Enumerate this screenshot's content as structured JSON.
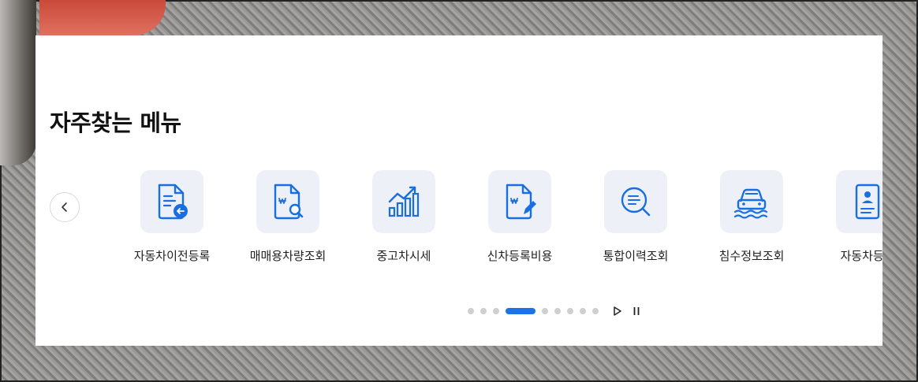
{
  "section": {
    "title": "자주찾는 메뉴"
  },
  "menu_items": [
    {
      "label": "자동차이전등록",
      "icon": "document-transfer-icon"
    },
    {
      "label": "매매용차량조회",
      "icon": "document-search-icon"
    },
    {
      "label": "중고차시세",
      "icon": "trend-chart-icon"
    },
    {
      "label": "신차등록비용",
      "icon": "document-edit-icon"
    },
    {
      "label": "통합이력조회",
      "icon": "magnifier-list-icon"
    },
    {
      "label": "침수정보조회",
      "icon": "flooded-car-icon"
    },
    {
      "label": "자동차등록",
      "icon": "id-card-icon"
    }
  ],
  "pagination": {
    "total": 10,
    "active_index": 3
  },
  "colors": {
    "accent": "#1a73e8",
    "icon_bg": "#edf1f7",
    "text": "#222222"
  }
}
